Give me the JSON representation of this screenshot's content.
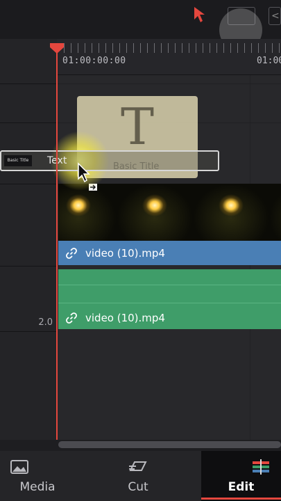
{
  "ruler": {
    "timecode_start": "01:00:00:00",
    "timecode_next": "01:00"
  },
  "tracks": {
    "audio_level": "2.0"
  },
  "title_clip": {
    "glyph": "T",
    "name": "Basic Title"
  },
  "drag_item": {
    "thumb_text": "Basic Title",
    "label": "Text"
  },
  "video_clip": {
    "name": "video (10).mp4"
  },
  "audio_clip": {
    "name": "video (10).mp4"
  },
  "nav": {
    "items": [
      {
        "label": "Media"
      },
      {
        "label": "Cut"
      },
      {
        "label": "Edit"
      }
    ],
    "active": "Edit"
  },
  "colors": {
    "playhead": "#e5473e",
    "video_clip": "#4a7fb5",
    "audio_clip": "#3f9d69",
    "title_clip": "#cdc6a4"
  },
  "icons": [
    "pointer-icon",
    "link-icon",
    "media-icon",
    "cut-icon",
    "edit-icon"
  ]
}
